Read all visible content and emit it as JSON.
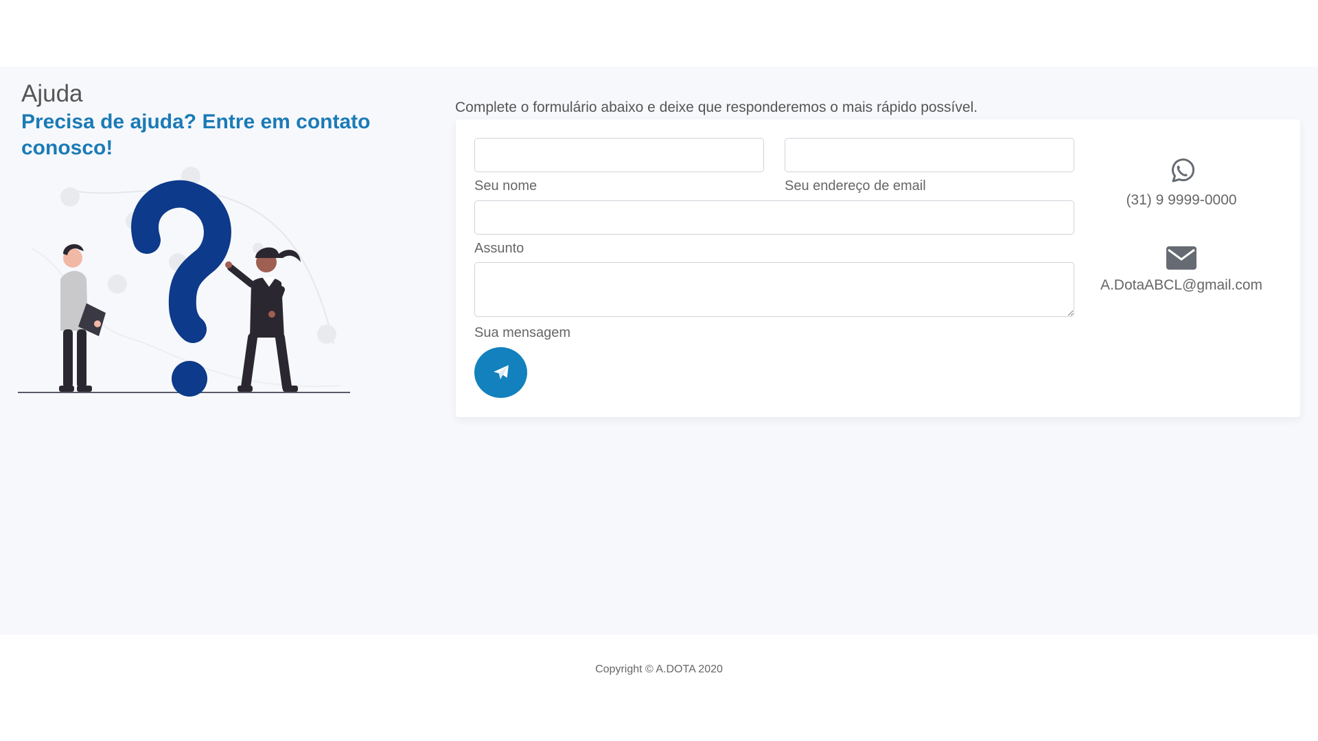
{
  "header": {
    "title": "Ajuda",
    "subtitle": "Precisa de ajuda? Entre em contato conosco!"
  },
  "form": {
    "intro": "Complete o formulário abaixo e deixe que responderemos o mais rápido possível.",
    "name_label": "Seu nome",
    "name_value": "",
    "email_label": "Seu endereço de email",
    "email_value": "",
    "subject_label": "Assunto",
    "subject_value": "",
    "message_label": "Sua mensagem",
    "message_value": "",
    "send_icon": "paper-plane-icon"
  },
  "contact": {
    "phone_icon": "whatsapp-icon",
    "phone": "(31) 9 9999-0000",
    "email_icon": "envelope-icon",
    "email": "A.DotaABCL@gmail.com"
  },
  "illustration": {
    "icon": "help-question-mark-illustration"
  },
  "footer": {
    "copyright": "Copyright © A.DOTA 2020"
  },
  "colors": {
    "accent": "#1a7bb6",
    "button": "#1281bd",
    "page_background": "#f7f8fc",
    "illustration_navy": "#0d3a8a"
  }
}
